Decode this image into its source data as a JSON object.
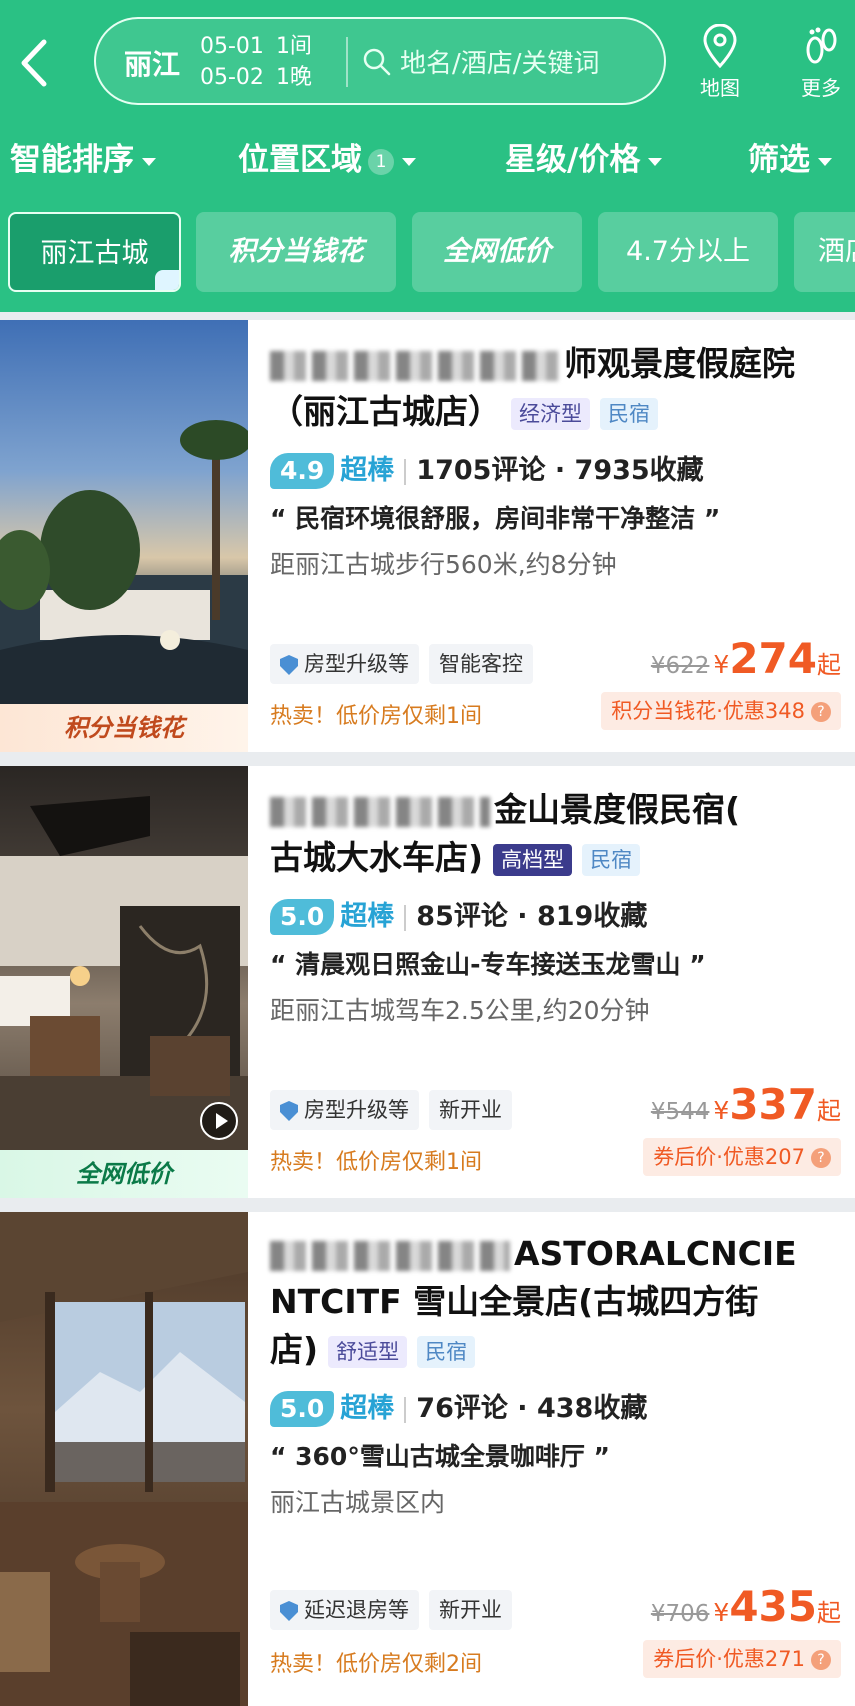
{
  "header": {
    "city": "丽江",
    "checkin_date": "05-01",
    "checkout_date": "05-02",
    "rooms": "1间",
    "nights": "1晚",
    "search_placeholder": "地名/酒店/关键词",
    "map_label": "地图",
    "more_label": "更多"
  },
  "filters": [
    {
      "label": "智能排序"
    },
    {
      "label": "位置区域",
      "count": "1"
    },
    {
      "label": "星级/价格"
    },
    {
      "label": "筛选"
    }
  ],
  "chips": [
    "丽江古城",
    "积分当钱花",
    "全网低价",
    "4.7分以上",
    "酒店"
  ],
  "hotels": [
    {
      "name_visible": "师观景度假庭院",
      "name_line2": "（丽江古城店）",
      "type_tag": "经济型",
      "category_tag": "民宿",
      "score": "4.9",
      "score_label": "超棒",
      "reviews": "1705评论",
      "favorites": "7935收藏",
      "quote": "“ 民宿环境很舒服，房间非常干净整洁 ”",
      "distance": "距丽江古城步行560米,约8分钟",
      "facilities": [
        "房型升级等",
        "智能客控"
      ],
      "hot_text": "热卖！低价房仅剩1间",
      "original_price": "¥622",
      "currency": "¥",
      "price": "274",
      "price_suffix": "起",
      "discount": "积分当钱花·优惠348",
      "promo": "积分当钱花"
    },
    {
      "name_visible": "金山景度假民宿(",
      "name_line2": "古城大水车店)",
      "type_tag": "高档型",
      "category_tag": "民宿",
      "score": "5.0",
      "score_label": "超棒",
      "reviews": "85评论",
      "favorites": "819收藏",
      "quote": "“ 清晨观日照金山-专车接送玉龙雪山 ”",
      "distance": "距丽江古城驾车2.5公里,约20分钟",
      "facilities": [
        "房型升级等",
        "新开业"
      ],
      "hot_text": "热卖！低价房仅剩1间",
      "original_price": "¥544",
      "currency": "¥",
      "price": "337",
      "price_suffix": "起",
      "discount": "券后价·优惠207",
      "promo": "全网低价"
    },
    {
      "name_visible": "ASTORALCNCIE",
      "name_line2": "NTCITF 雪山全景店(古城四方街",
      "name_line3": "店)",
      "type_tag": "舒适型",
      "category_tag": "民宿",
      "score": "5.0",
      "score_label": "超棒",
      "reviews": "76评论",
      "favorites": "438收藏",
      "quote": "“ 360°雪山古城全景咖啡厅 ”",
      "distance": "丽江古城景区内",
      "facilities": [
        "延迟退房等",
        "新开业"
      ],
      "hot_text": "热卖！低价房仅剩2间",
      "original_price": "¥706",
      "currency": "¥",
      "price": "435",
      "price_suffix": "起",
      "discount": "券后价·优惠271"
    }
  ],
  "dot": "·",
  "question_mark": "?"
}
